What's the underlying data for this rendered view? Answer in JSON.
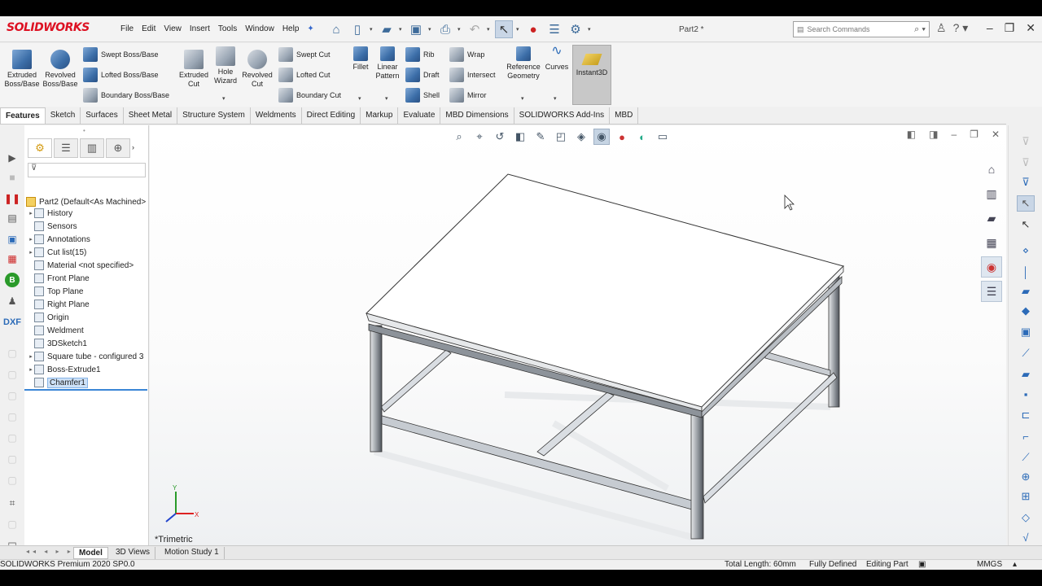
{
  "app": {
    "logo": "SOLIDWORKS",
    "doc_title": "Part2 *"
  },
  "menu": [
    "File",
    "Edit",
    "View",
    "Insert",
    "Tools",
    "Window",
    "Help"
  ],
  "search": {
    "placeholder": "Search Commands"
  },
  "ribbon": {
    "extruded_boss": "Extruded Boss/Base",
    "revolved_boss": "Revolved Boss/Base",
    "swept_boss": "Swept Boss/Base",
    "lofted_boss": "Lofted Boss/Base",
    "boundary_boss": "Boundary Boss/Base",
    "extruded_cut": "Extruded Cut",
    "hole_wizard": "Hole Wizard",
    "revolved_cut": "Revolved Cut",
    "swept_cut": "Swept Cut",
    "lofted_cut": "Lofted Cut",
    "boundary_cut": "Boundary Cut",
    "fillet": "Fillet",
    "linear_pattern": "Linear Pattern",
    "rib": "Rib",
    "draft": "Draft",
    "shell": "Shell",
    "wrap": "Wrap",
    "intersect": "Intersect",
    "mirror": "Mirror",
    "reference_geometry": "Reference Geometry",
    "curves": "Curves",
    "instant3d": "Instant3D"
  },
  "command_tabs": [
    "Features",
    "Sketch",
    "Surfaces",
    "Sheet Metal",
    "Structure System",
    "Weldments",
    "Direct Editing",
    "Markup",
    "Evaluate",
    "MBD Dimensions",
    "SOLIDWORKS Add-Ins",
    "MBD"
  ],
  "tree": {
    "root": "Part2  (Default<As Machined>",
    "items": [
      {
        "label": "History",
        "expand": true
      },
      {
        "label": "Sensors",
        "expand": false
      },
      {
        "label": "Annotations",
        "expand": true
      },
      {
        "label": "Cut list(15)",
        "expand": true
      },
      {
        "label": "Material <not specified>",
        "expand": false
      },
      {
        "label": "Front Plane",
        "expand": false
      },
      {
        "label": "Top Plane",
        "expand": false
      },
      {
        "label": "Right Plane",
        "expand": false
      },
      {
        "label": "Origin",
        "expand": false
      },
      {
        "label": "Weldment",
        "expand": false
      },
      {
        "label": "3DSketch1",
        "expand": false
      },
      {
        "label": "Square tube - configured 3",
        "expand": true
      },
      {
        "label": "Boss-Extrude1",
        "expand": true
      },
      {
        "label": "Chamfer1",
        "expand": false,
        "selected": true
      }
    ]
  },
  "viewport": {
    "view_label": "*Trimetric",
    "triad_x": "X",
    "triad_y": "Y"
  },
  "bottom_tabs": [
    "Model",
    "3D Views",
    "Motion Study 1"
  ],
  "status": {
    "product": "SOLIDWORKS Premium 2020 SP0.0",
    "total_length": "Total Length: 60mm",
    "defined": "Fully Defined",
    "mode": "Editing Part",
    "units": "MMGS"
  }
}
